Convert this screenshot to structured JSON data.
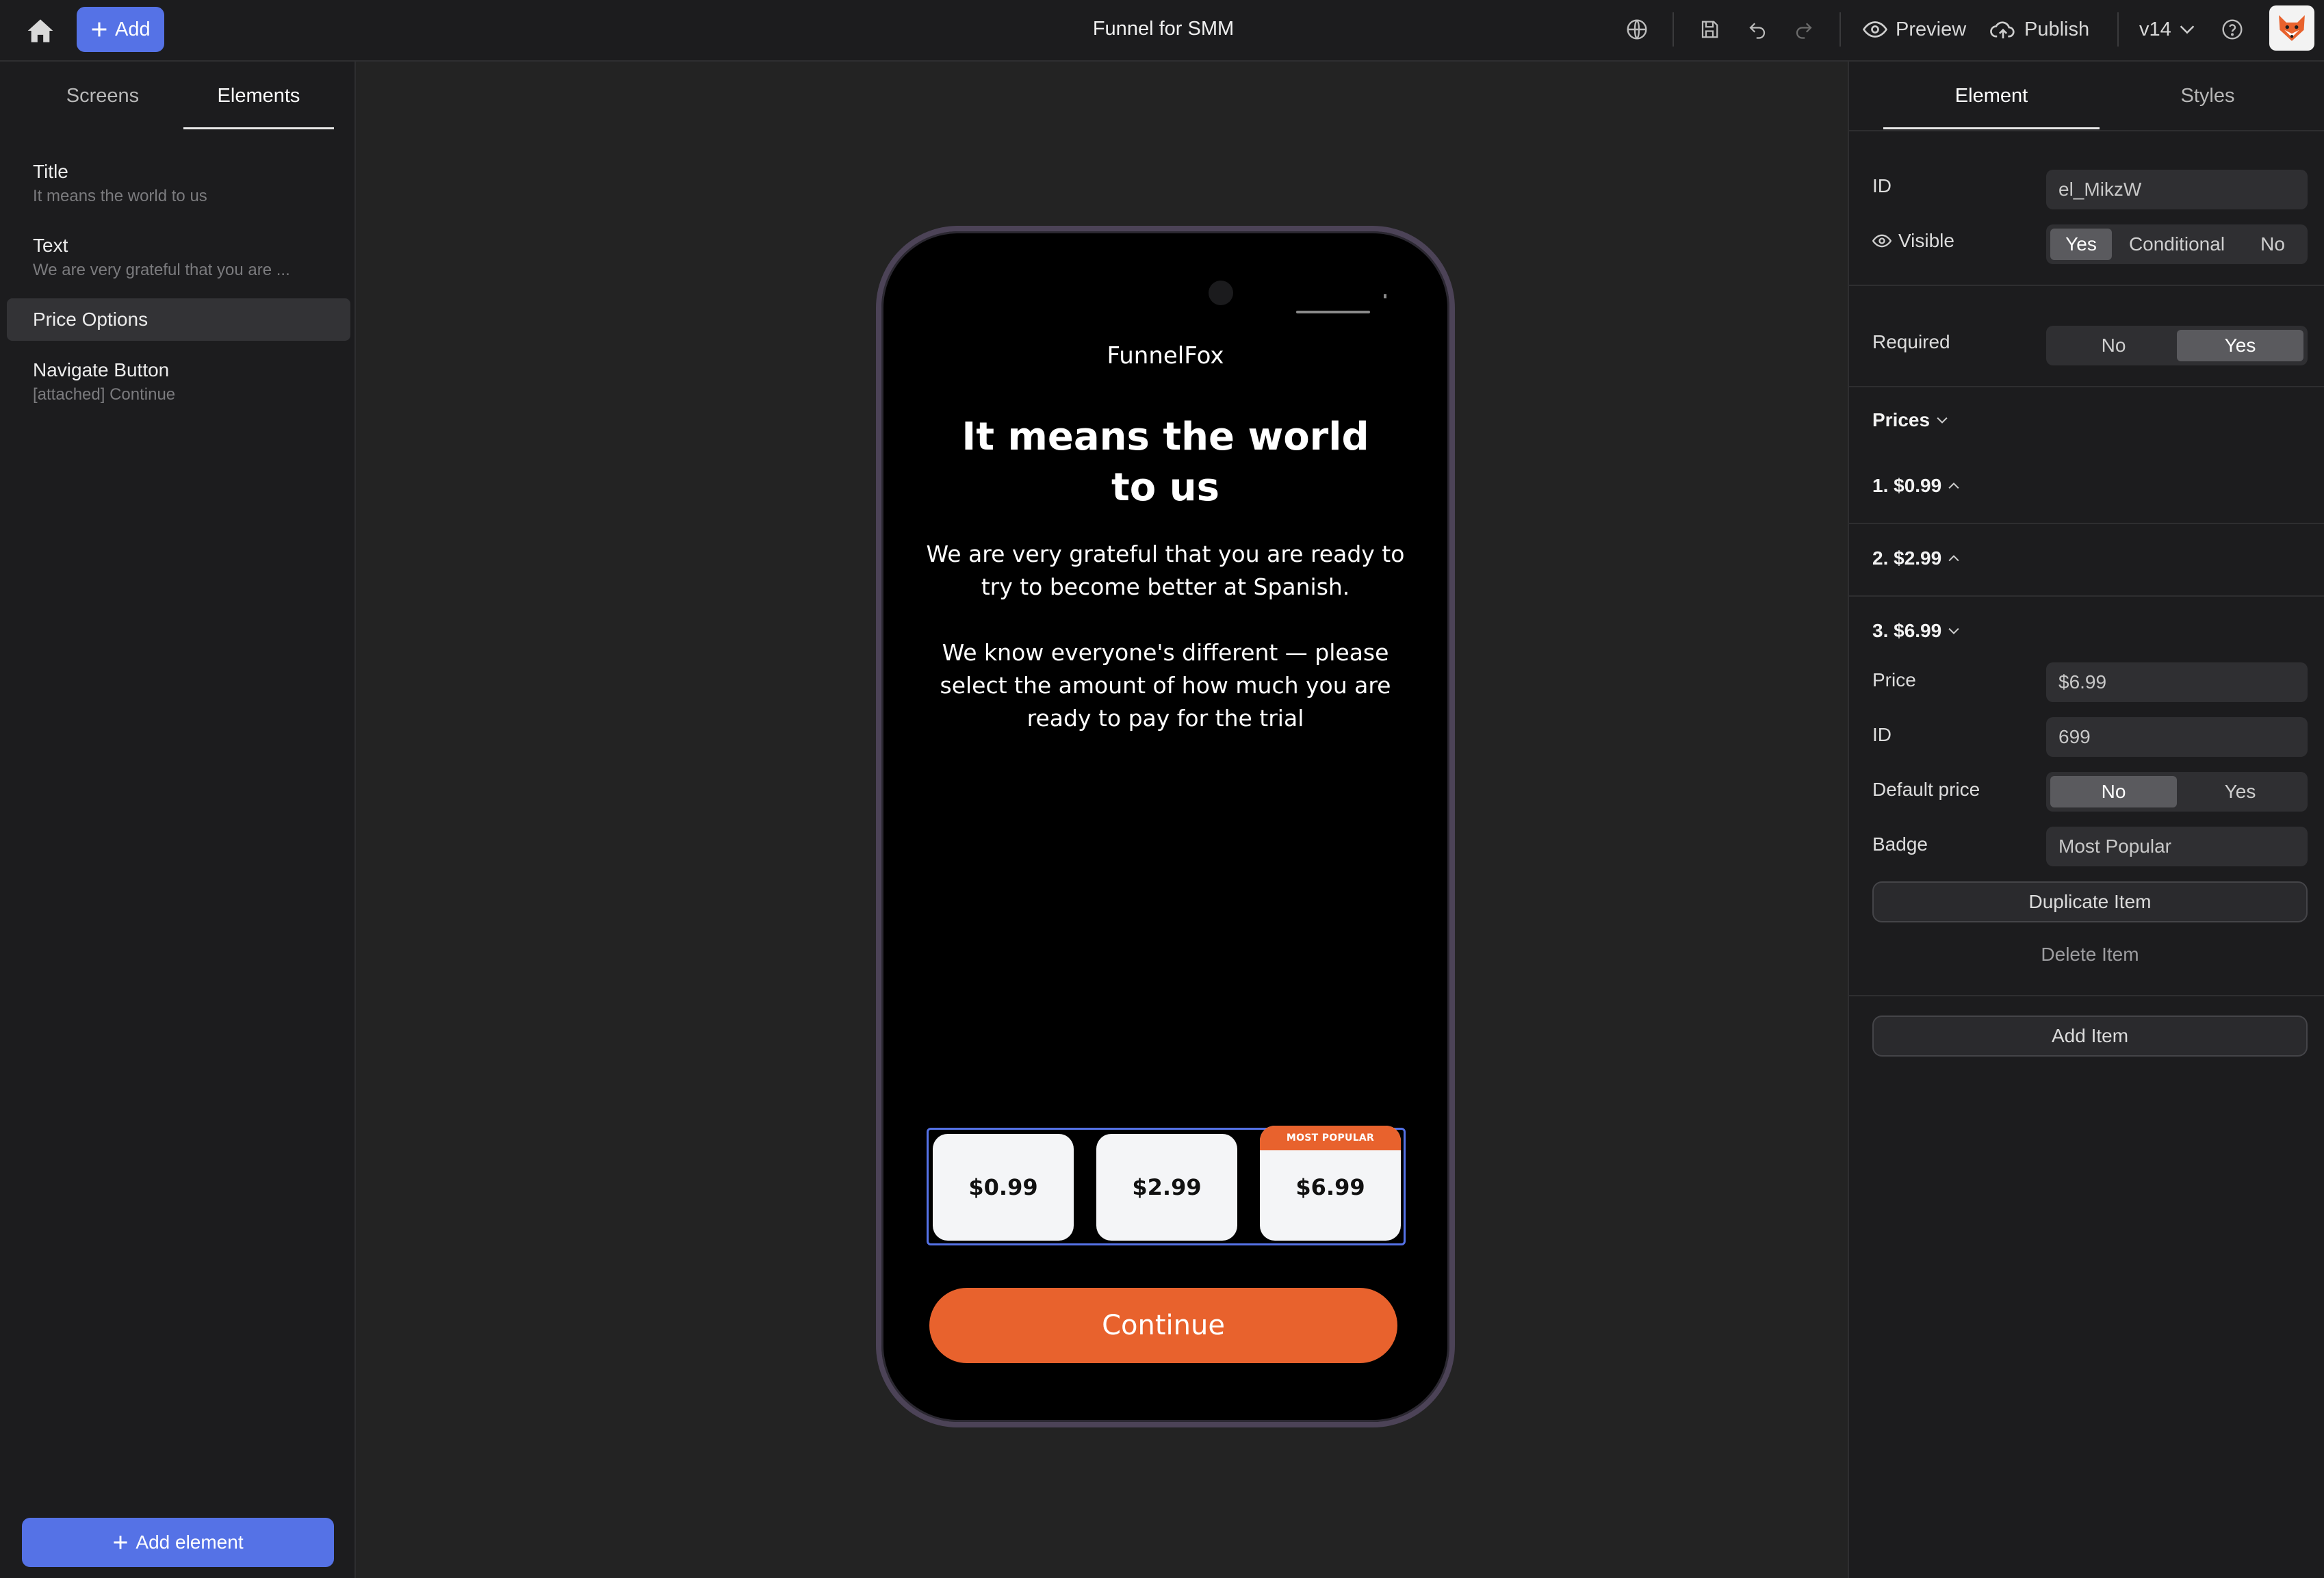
{
  "topbar": {
    "add_label": "Add",
    "title": "Funnel for SMM",
    "preview_label": "Preview",
    "publish_label": "Publish",
    "version_label": "v14"
  },
  "left": {
    "tabs": [
      "Screens",
      "Elements"
    ],
    "active_tab": "Elements",
    "elements": [
      {
        "title": "Title",
        "subtitle": "It means the world to us"
      },
      {
        "title": "Text",
        "subtitle": "We are very grateful that you are ..."
      },
      {
        "title": "Price Options",
        "subtitle": ""
      },
      {
        "title": "Navigate Button",
        "subtitle": "[attached] Continue"
      }
    ],
    "add_element_label": "Add element"
  },
  "phone": {
    "brand": "FunnelFox",
    "title_line1": "It means the world",
    "title_line2": "to us",
    "text_p1": "We are very grateful that you are ready to try to become better at Spanish.",
    "text_p2": "We know everyone's different — please select the amount of how much you are ready to pay for the trial",
    "prices": [
      {
        "label": "$0.99",
        "badge": ""
      },
      {
        "label": "$2.99",
        "badge": ""
      },
      {
        "label": "$6.99",
        "badge": "MOST POPULAR"
      }
    ],
    "continue_label": "Continue"
  },
  "right": {
    "tabs": [
      "Element",
      "Styles"
    ],
    "active_tab": "Element",
    "id_label": "ID",
    "id_value": "el_MikzW",
    "visible_label": "Visible",
    "visible_options": [
      "Yes",
      "Conditional",
      "No"
    ],
    "visible_selected": "Yes",
    "required_label": "Required",
    "required_options": [
      "No",
      "Yes"
    ],
    "required_selected": "Yes",
    "prices_label": "Prices",
    "price_items": [
      "1. $0.99",
      "2. $2.99",
      "3. $6.99"
    ],
    "item": {
      "price_label": "Price",
      "price_value": "$6.99",
      "id_label": "ID",
      "id_value": "699",
      "default_label": "Default price",
      "default_options": [
        "No",
        "Yes"
      ],
      "default_selected": "No",
      "badge_label": "Badge",
      "badge_value": "Most Popular"
    },
    "duplicate_label": "Duplicate Item",
    "delete_label": "Delete Item",
    "add_item_label": "Add Item"
  },
  "colors": {
    "accent": "#5572e6",
    "cta": "#e8622d",
    "panel": "#1c1c1e",
    "canvas": "#232323"
  }
}
